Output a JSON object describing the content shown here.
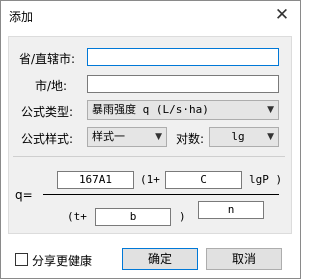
{
  "window": {
    "title": "添加"
  },
  "form": {
    "province_label": "省/直辖市:",
    "province_value": "",
    "city_label": "市/地:",
    "city_value": "",
    "formula_type_label": "公式类型:",
    "formula_type_value": "暴雨强度 q (L/s·ha)",
    "formula_style_label": "公式样式:",
    "formula_style_value": "样式一",
    "log_label": "对数:",
    "log_value": "lg"
  },
  "formula": {
    "q_label": "q=",
    "a_value": "167A1",
    "open_paren": "(1+",
    "c_value": "C",
    "lgp_text": "lgP )",
    "t_prefix": "(t+",
    "b_value": "b",
    "close_paren": ")",
    "n_value": "n"
  },
  "footer": {
    "share_label": "分享更健康",
    "ok_label": "确定",
    "cancel_label": "取消"
  },
  "colors": {
    "focus_border": "#0078d7",
    "panel_bg": "#f0f0f0"
  }
}
